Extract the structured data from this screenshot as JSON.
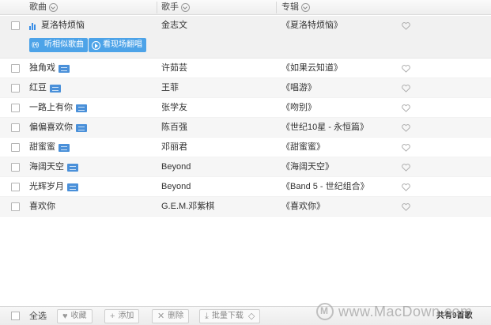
{
  "header": {
    "col_song": "歌曲",
    "col_artist": "歌手",
    "col_album": "专辑"
  },
  "playing": {
    "title": "夏洛特烦恼",
    "artist": "金志文",
    "album": "《夏洛特烦恼》",
    "btn_listen": "听相似歌曲",
    "btn_live": "看现场翻唱"
  },
  "songs": [
    {
      "title": "独角戏",
      "artist": "许茹芸",
      "album": "《如果云知道》",
      "mv": true
    },
    {
      "title": "红豆",
      "artist": "王菲",
      "album": "《唱游》",
      "mv": true
    },
    {
      "title": "一路上有你",
      "artist": "张学友",
      "album": "《吻别》",
      "mv": true
    },
    {
      "title": "偏偏喜欢你",
      "artist": "陈百强",
      "album": "《世纪10星 - 永恒篇》",
      "mv": true
    },
    {
      "title": "甜蜜蜜",
      "artist": "邓丽君",
      "album": "《甜蜜蜜》",
      "mv": true
    },
    {
      "title": "海阔天空",
      "artist": "Beyond",
      "album": "《海阔天空》",
      "mv": true
    },
    {
      "title": "光辉岁月",
      "artist": "Beyond",
      "album": "《Band 5 - 世纪组合》",
      "mv": true
    },
    {
      "title": "喜欢你",
      "artist": "G.E.M.邓紫棋",
      "album": "《喜欢你》",
      "mv": false
    }
  ],
  "footer": {
    "select_all": "全选",
    "collect": "收藏",
    "add": "添加",
    "delete": "删除",
    "batch_download": "批量下载",
    "total": "共有9首歌"
  },
  "watermark": "www.MacDown.com",
  "colors": {
    "accent": "#4da3e8",
    "mv_badge": "#4a90d9"
  }
}
